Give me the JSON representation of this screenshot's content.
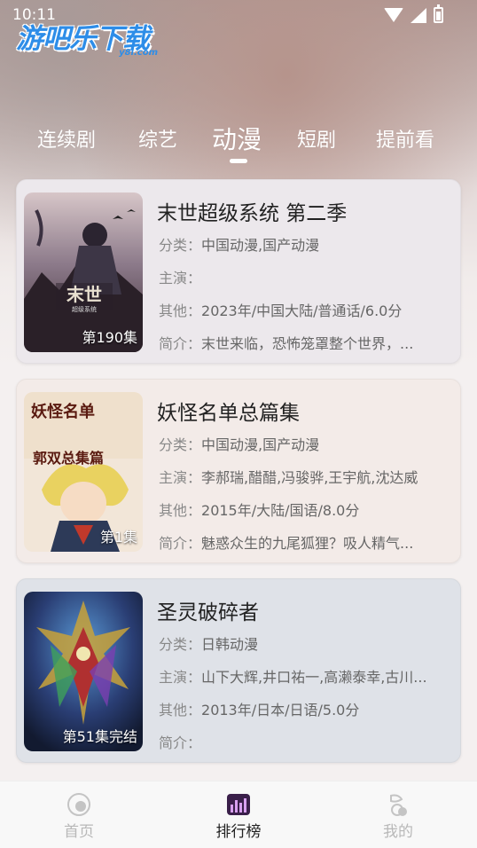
{
  "status_bar": {
    "time": "10:11"
  },
  "logo": {
    "text": "游吧乐下载",
    "sub": "y8l.com"
  },
  "tabs": [
    {
      "label": "连续剧",
      "active": false
    },
    {
      "label": "综艺",
      "active": false
    },
    {
      "label": "动漫",
      "active": true
    },
    {
      "label": "短剧",
      "active": false
    },
    {
      "label": "提前看",
      "active": false
    }
  ],
  "items": [
    {
      "title": "末世超级系统 第二季",
      "episode": "第190集",
      "category_key": "分类：",
      "category": "中国动漫,国产动漫",
      "cast_key": "主演：",
      "cast": "",
      "other_key": "其他：",
      "other": "2023年/中国大陆/普通话/6.0分",
      "intro_key": "简介：",
      "intro": "末世来临，恐怖笼罩整个世界，...",
      "poster_text": "末世",
      "poster_sub": "超级系统"
    },
    {
      "title": "妖怪名单总篇集",
      "episode": "第1集",
      "category_key": "分类：",
      "category": "中国动漫,国产动漫",
      "cast_key": "主演：",
      "cast": "李郝瑞,醋醋,冯骏骅,王宇航,沈达威",
      "other_key": "其他：",
      "other": "2015年/大陆/国语/8.0分",
      "intro_key": "简介：",
      "intro": "魅惑众生的九尾狐狸？吸人精气...",
      "poster_text": "妖怪名单",
      "poster_sub": "郭双总集篇"
    },
    {
      "title": "圣灵破碎者",
      "episode": "第51集完结",
      "category_key": "分类：",
      "category": "日韩动漫",
      "cast_key": "主演：",
      "cast": "山下大辉,井口祐一,高濑泰幸,古川...",
      "other_key": "其他：",
      "other": "2013年/日本/日语/5.0分",
      "intro_key": "简介：",
      "intro": ""
    }
  ],
  "bottom_nav": [
    {
      "label": "首页",
      "icon": "home-icon",
      "active": false
    },
    {
      "label": "排行榜",
      "icon": "chart-icon",
      "active": true
    },
    {
      "label": "我的",
      "icon": "profile-icon",
      "active": false
    }
  ],
  "colors": {
    "accent": "#6a3fa0",
    "nav_inactive": "#b8b8b8",
    "nav_active": "#222222"
  }
}
